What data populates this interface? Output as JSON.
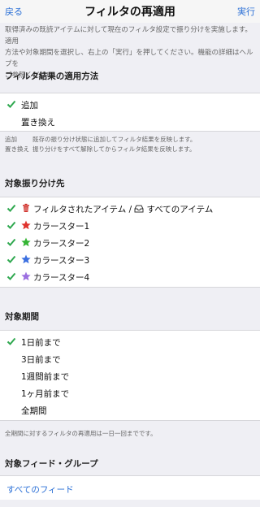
{
  "nav": {
    "back": "戻る",
    "title": "フィルタの再適用",
    "run": "実行"
  },
  "intro": {
    "line1": "取得済みの既読アイテムに対して現在のフィルタ設定で振り分けを実施します。適用",
    "line2": "方法や対象期間を選択し、右上の「実行」を押してください。機能の詳細はヘルプを",
    "line3": "ご参照ください。"
  },
  "apply_method": {
    "header": "フィルタ結果の適用方法",
    "options": [
      {
        "label": "追加",
        "checked": true
      },
      {
        "label": "置き換え",
        "checked": false
      }
    ],
    "notes": [
      {
        "key": "追加",
        "text": "既存の振り分け状態に追加してフィルタ結果を反映します。"
      },
      {
        "key": "置き換え",
        "text": "振り分けをすべて解除してからフィルタ結果を反映します。"
      }
    ]
  },
  "targets": {
    "header": "対象振り分け先",
    "items": [
      {
        "label": "フィルタされたアイテム / ",
        "label_b": "すべてのアイテム",
        "icon": "trash-icon",
        "icon_b": "inbox-icon",
        "checked": true
      },
      {
        "label": "カラースター1",
        "icon": "star-red-icon",
        "color": "#e0332e",
        "checked": true
      },
      {
        "label": "カラースター2",
        "icon": "star-green-icon",
        "color": "#35b535",
        "checked": true
      },
      {
        "label": "カラースター3",
        "icon": "star-blue-icon",
        "color": "#3b6fe0",
        "checked": true
      },
      {
        "label": "カラースター4",
        "icon": "star-purple-icon",
        "color": "#9b6fe0",
        "checked": true
      }
    ]
  },
  "period": {
    "header": "対象期間",
    "options": [
      {
        "label": "1日前まで",
        "checked": true
      },
      {
        "label": "3日前まで",
        "checked": false
      },
      {
        "label": "1週間前まで",
        "checked": false
      },
      {
        "label": "1ヶ月前まで",
        "checked": false
      },
      {
        "label": "全期間",
        "checked": false
      }
    ],
    "note": "全期間に対するフィルタの再適用は一日一回までです。"
  },
  "feed_group": {
    "header": "対象フィード・グループ",
    "value": "すべてのフィード"
  },
  "colors": {
    "check": "#2fa84f",
    "link": "#2a6fd6"
  }
}
